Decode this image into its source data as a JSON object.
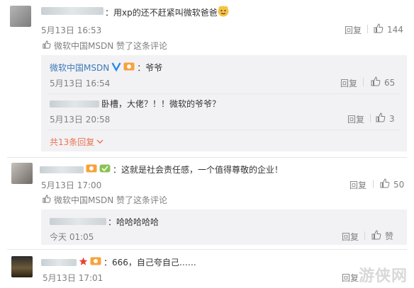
{
  "c1": {
    "text": "：用xp的还不赶紧叫微软爸爸",
    "time": "5月13日 16:53",
    "reply": "回复",
    "likes": "144",
    "liked_by": "微软中国MSDN 赞了这条评论",
    "icons": [
      "user-avatar",
      "cat-emoji",
      "thumb-up-icon",
      "thumb-icon"
    ]
  },
  "r1": {
    "name": "微软中国MSDN",
    "text": "：爷爷",
    "time": "5月13日 16:54",
    "reply": "回复",
    "likes": "65",
    "icons": [
      "verified-v-icon",
      "fan-badge-icon"
    ]
  },
  "r2": {
    "text": "卧槽，大佬？！！微软的爷爷？",
    "time": "5月13日 20:58",
    "reply": "回复",
    "likes": "3"
  },
  "more": "共13条回复",
  "c2": {
    "text": "：这就是社会责任感，一个值得尊敬的企业！",
    "time": "5月13日 17:00",
    "reply": "回复",
    "likes": "50",
    "liked_by": "微软中国MSDN 赞了这条评论"
  },
  "r3": {
    "text": "：哈哈哈哈哈",
    "time": "今天 01:05",
    "reply": "回复",
    "likes": "赞"
  },
  "c3": {
    "text": "：666，自己夸自己……",
    "time": "5月13日 17:01",
    "reply": "回复"
  },
  "watermark": "游侠网",
  "colors": {
    "accent": "#eb7350",
    "link_blue": "#3f78b7",
    "muted": "#808080",
    "sub_bg": "#f2f2f5"
  }
}
